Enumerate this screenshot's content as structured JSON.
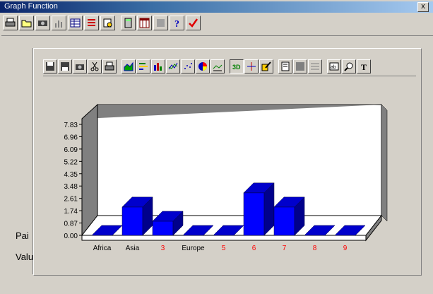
{
  "window": {
    "title": "Graph Function",
    "close_label": "x"
  },
  "toolbar_main": [
    {
      "name": "print-icon"
    },
    {
      "name": "open-folder-icon"
    },
    {
      "name": "camera-icon"
    },
    {
      "name": "bar-chart-icon"
    },
    {
      "name": "table-icon"
    },
    {
      "name": "list-icon"
    },
    {
      "name": "settings-icon"
    },
    {
      "name": "calculator-icon"
    },
    {
      "name": "grid-icon"
    },
    {
      "name": "disk-icon"
    },
    {
      "name": "help-icon"
    },
    {
      "name": "checkmark-icon"
    }
  ],
  "toolbar_chart": [
    {
      "name": "save-icon"
    },
    {
      "name": "save-as-icon"
    },
    {
      "name": "camera-icon"
    },
    {
      "name": "scissors-icon"
    },
    {
      "name": "print-icon"
    },
    {
      "name": "area-chart-icon"
    },
    {
      "name": "horizontal-bar-icon"
    },
    {
      "name": "bar-chart-icon"
    },
    {
      "name": "line-chart-icon"
    },
    {
      "name": "scatter-chart-icon"
    },
    {
      "name": "pie-chart-icon"
    },
    {
      "name": "line-area-icon"
    },
    {
      "name": "3d-toggle-icon"
    },
    {
      "name": "rotate-icon"
    },
    {
      "name": "edit-icon"
    },
    {
      "name": "document-icon"
    },
    {
      "name": "fill-icon"
    },
    {
      "name": "grid-lines-icon"
    },
    {
      "name": "text-label-icon"
    },
    {
      "name": "zoom-icon"
    },
    {
      "name": "title-icon"
    }
  ],
  "side_labels": {
    "pair": "Pai",
    "value": "Valu"
  },
  "colors": {
    "bar_front": "#0000ff",
    "bar_top": "#0000cc",
    "bar_side": "#00008b",
    "label_red": "#ff0000",
    "label_black": "#000000"
  },
  "chart_data": {
    "type": "bar",
    "categories": [
      "Africa",
      "Asia",
      "3",
      "Europe",
      "5",
      "6",
      "7",
      "8",
      "9"
    ],
    "category_colors": [
      "#000000",
      "#000000",
      "#ff0000",
      "#000000",
      "#ff0000",
      "#ff0000",
      "#ff0000",
      "#ff0000",
      "#ff0000"
    ],
    "values": [
      0,
      2,
      1,
      0,
      0,
      3,
      2,
      0,
      0
    ],
    "yticks": [
      "0.00",
      "0.87",
      "1.74",
      "2.61",
      "3.48",
      "4.35",
      "5.22",
      "6.09",
      "6.96",
      "7.83"
    ],
    "ylim": [
      0,
      7.83
    ],
    "title": "",
    "xlabel": "",
    "ylabel": "",
    "three_d": true
  }
}
